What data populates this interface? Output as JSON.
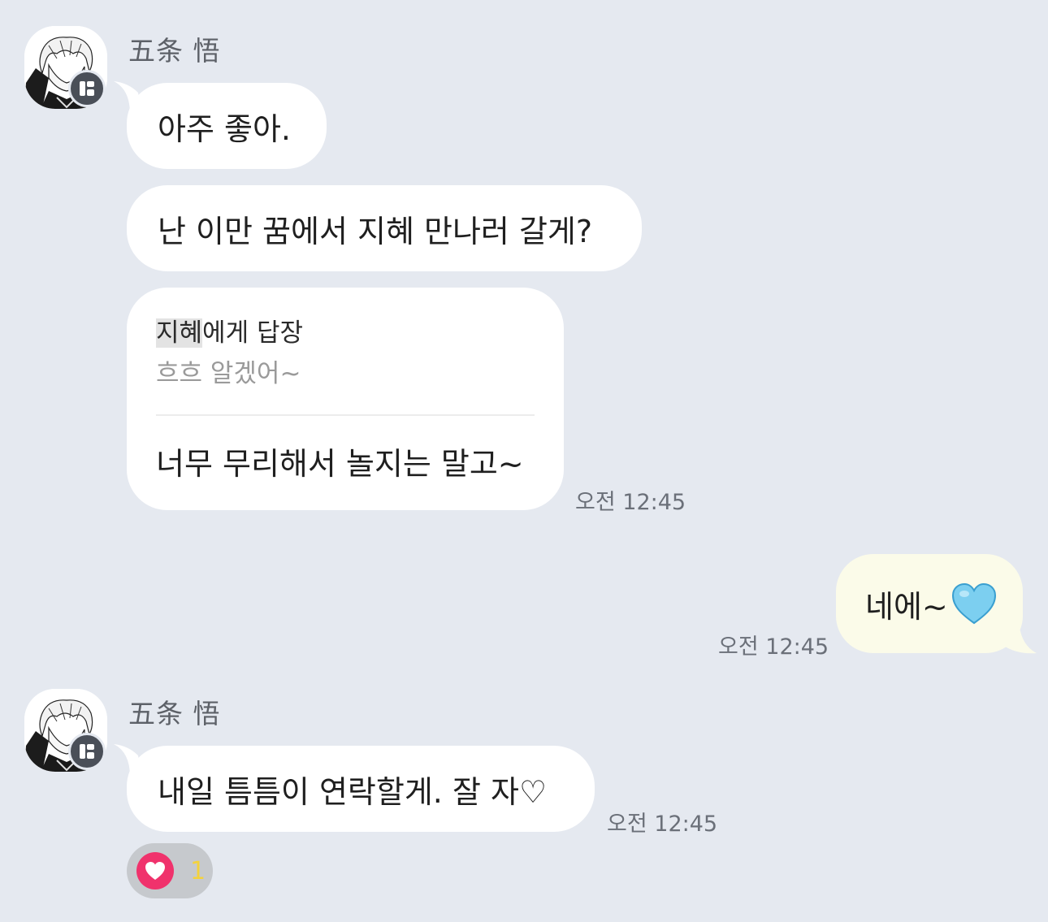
{
  "messages": {
    "group1": {
      "sender_name": "五条 悟",
      "bubble1": "아주 좋아.",
      "bubble2": "난 이만 꿈에서 지혜 만나러 갈게?",
      "reply": {
        "to_name": "지혜",
        "to_suffix": "에게 답장",
        "quote": "흐흐 알겠어~",
        "body": "너무 무리해서 놀지는 말고~",
        "time": "오전 12:45"
      }
    },
    "mine": {
      "text": "네에~",
      "emoji": "light-blue-heart-emoji",
      "time": "오전 12:45"
    },
    "group2": {
      "sender_name": "五条 悟",
      "bubble": "내일 틈틈이 연락할게. 잘 자♡",
      "time": "오전 12:45",
      "reaction": {
        "icon": "heart-icon",
        "count": "1"
      }
    }
  },
  "colors": {
    "background": "#e5e9f0",
    "incoming_bubble": "#ffffff",
    "outgoing_bubble": "#fbfbe9",
    "reaction_heart": "#f0326c",
    "reaction_count": "#f4d23c"
  }
}
